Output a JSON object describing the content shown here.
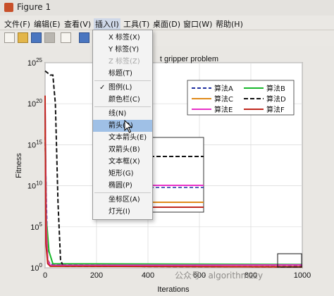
{
  "window": {
    "title": "Figure 1"
  },
  "menubar": [
    {
      "label": "文件(F)",
      "x": 6
    },
    {
      "label": "编辑(E)",
      "x": 48
    },
    {
      "label": "查看(V)",
      "x": 91
    },
    {
      "label": "插入(I)",
      "x": 135,
      "active": true
    },
    {
      "label": "工具(T)",
      "x": 175
    },
    {
      "label": "桌面(D)",
      "x": 217
    },
    {
      "label": "窗口(W)",
      "x": 260
    },
    {
      "label": "帮助(H)",
      "x": 306
    }
  ],
  "insert_menu": {
    "items": [
      {
        "label": "X 标签(X)"
      },
      {
        "label": "Y 标签(Y)"
      },
      {
        "label": "Z 标签(Z)",
        "disabled": true
      },
      {
        "label": "标题(T)"
      },
      {
        "label": "图例(L)",
        "checked": true,
        "separator_before": true
      },
      {
        "label": "颜色栏(C)"
      },
      {
        "label": "线(N)",
        "separator_before": true
      },
      {
        "label": "箭头(R)",
        "highlighted": true
      },
      {
        "label": "文本箭头(E)"
      },
      {
        "label": "双箭头(B)"
      },
      {
        "label": "文本框(X)"
      },
      {
        "label": "矩形(G)"
      },
      {
        "label": "椭圆(P)"
      },
      {
        "label": "坐标区(A)",
        "separator_before": true
      },
      {
        "label": "灯光(I)"
      }
    ]
  },
  "chart_data": {
    "type": "line",
    "title": "t gripper problem",
    "xlabel": "Iterations",
    "ylabel": "Fitness",
    "xlim": [
      0,
      1000
    ],
    "ylim_exponent": [
      0,
      25
    ],
    "yscale": "log",
    "xticks": [
      "0",
      "200",
      "400",
      "600",
      "800",
      "1000"
    ],
    "yticks": [
      {
        "base": "10",
        "exp": "25",
        "value": 25
      },
      {
        "base": "10",
        "exp": "20",
        "value": 20
      },
      {
        "base": "10",
        "exp": "15",
        "value": 15
      },
      {
        "base": "10",
        "exp": "10",
        "value": 10
      },
      {
        "base": "10",
        "exp": "5",
        "value": 5
      },
      {
        "base": "10",
        "exp": "0",
        "value": 0
      }
    ],
    "grid": true,
    "legend_position": "top-right",
    "series": [
      {
        "name": "算法A",
        "color": "#1f2fa0",
        "dash": "5,3",
        "x": [
          0,
          5,
          10,
          20,
          1000
        ],
        "y": [
          16,
          8,
          1,
          0.4,
          0.3
        ]
      },
      {
        "name": "算法B",
        "color": "#18b82c",
        "dash": "",
        "x": [
          0,
          5,
          15,
          30,
          1000
        ],
        "y": [
          19,
          6,
          2,
          0.5,
          0.4
        ]
      },
      {
        "name": "算法C",
        "color": "#e08a1a",
        "dash": "",
        "x": [
          0,
          5,
          10,
          20,
          1000
        ],
        "y": [
          17,
          5,
          1,
          0.2,
          0.15
        ]
      },
      {
        "name": "算法D",
        "color": "#111111",
        "dash": "6,3",
        "x": [
          0,
          20,
          30,
          40,
          50,
          60,
          70,
          1000
        ],
        "y": [
          24,
          23.5,
          23.5,
          20,
          8,
          1,
          0.2,
          0.1
        ]
      },
      {
        "name": "算法E",
        "color": "#e832c8",
        "dash": "",
        "x": [
          0,
          5,
          10,
          20,
          1000
        ],
        "y": [
          20,
          4,
          0.8,
          0.3,
          0.35
        ]
      },
      {
        "name": "算法F",
        "color": "#c0281e",
        "dash": "",
        "x": [
          0,
          3,
          10,
          20,
          1000
        ],
        "y": [
          21,
          3,
          0.5,
          0.2,
          0.1
        ]
      }
    ]
  },
  "watermark": "公众号 · algorithmzzy"
}
